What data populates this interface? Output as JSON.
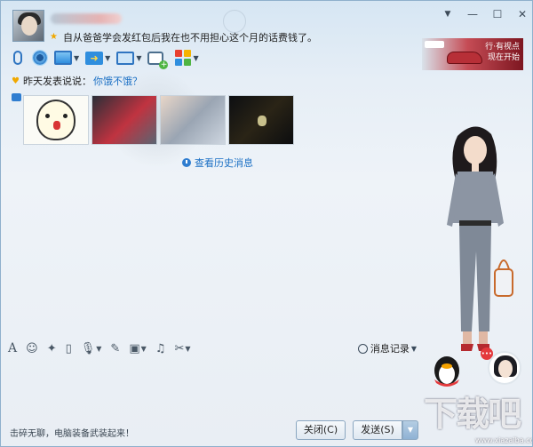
{
  "header": {
    "signature": "自从爸爸学会发红包后我在也不用担心这个月的话费钱了。"
  },
  "toolbar": {
    "items": [
      {
        "name": "voice",
        "icon": "microphone-icon"
      },
      {
        "name": "video",
        "icon": "camera-icon"
      },
      {
        "name": "screen-share",
        "icon": "screen-share-icon"
      },
      {
        "name": "file-transfer",
        "icon": "file-transfer-icon"
      },
      {
        "name": "remote-desktop",
        "icon": "remote-desktop-icon"
      },
      {
        "name": "group-chat",
        "icon": "add-chat-icon"
      },
      {
        "name": "apps",
        "icon": "apps-grid-icon"
      }
    ]
  },
  "chat": {
    "prev_post_label": "昨天发表说说：",
    "prev_post_link": "你饿不饿？",
    "history_link": "查看历史消息",
    "photos": [
      {
        "name": "photo-cartoon"
      },
      {
        "name": "photo-couple"
      },
      {
        "name": "photo-portrait"
      },
      {
        "name": "photo-dark"
      }
    ]
  },
  "ad": {
    "text_line1": "行·有视点",
    "text_line2": "现在开始"
  },
  "input_toolbar": {
    "history_label": "消息记录"
  },
  "footer": {
    "ad_text": "击碎无聊，电脑装备武装起来！",
    "close_label": "关闭(C)",
    "send_label": "发送(S)"
  },
  "watermark": {
    "text": "下载吧",
    "sub": "www.xiazaiba.com"
  },
  "colors": {
    "accent": "#2f75c1",
    "link": "#1a6fc4",
    "window_bg": "#e9eef4"
  }
}
